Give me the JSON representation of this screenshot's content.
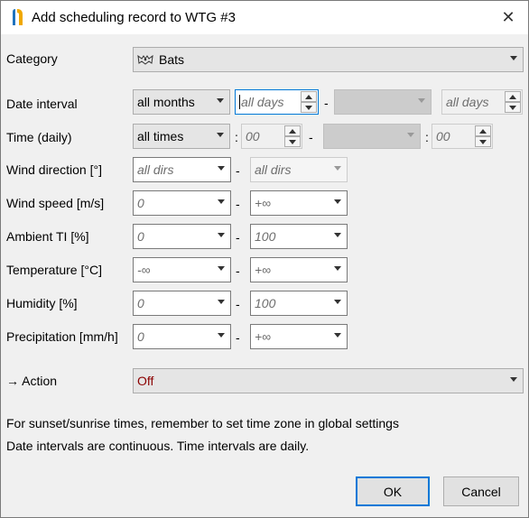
{
  "window": {
    "title": "Add scheduling record to WTG #3"
  },
  "labels": {
    "category": "Category",
    "date_interval": "Date interval",
    "time_daily": "Time (daily)",
    "wind_direction": "Wind direction [°]",
    "wind_speed": "Wind speed [m/s]",
    "ambient_ti": "Ambient TI [%]",
    "temperature": "Temperature [°C]",
    "humidity": "Humidity [%]",
    "precipitation": "Precipitation [mm/h]",
    "action": "→ Action"
  },
  "category": {
    "value": "Bats",
    "icon": "bat-icon"
  },
  "date_interval": {
    "months": "all months",
    "from_days": "all days",
    "to_months": "",
    "to_days": "all days",
    "sep": "-"
  },
  "time_daily": {
    "times": "all times",
    "from_time": "00",
    "to_time": "00",
    "colon": ":",
    "sep": "-"
  },
  "wind_direction": {
    "from": "all dirs",
    "to": "all dirs",
    "sep": "-"
  },
  "wind_speed": {
    "from": "0",
    "to": "+∞",
    "sep": "-"
  },
  "ambient_ti": {
    "from": "0",
    "to": "100",
    "sep": "-"
  },
  "temperature": {
    "from": "-∞",
    "to": "+∞",
    "sep": "-"
  },
  "humidity": {
    "from": "0",
    "to": "100",
    "sep": "-"
  },
  "precipitation": {
    "from": "0",
    "to": "+∞",
    "sep": "-"
  },
  "action": {
    "value": "Off",
    "color": "#8b0000"
  },
  "info": {
    "line1": "For sunset/sunrise times, remember to set time zone in global settings",
    "line2": "Date intervals are continuous. Time intervals are daily."
  },
  "buttons": {
    "ok": "OK",
    "cancel": "Cancel"
  },
  "colors": {
    "focus": "#0078d7"
  }
}
